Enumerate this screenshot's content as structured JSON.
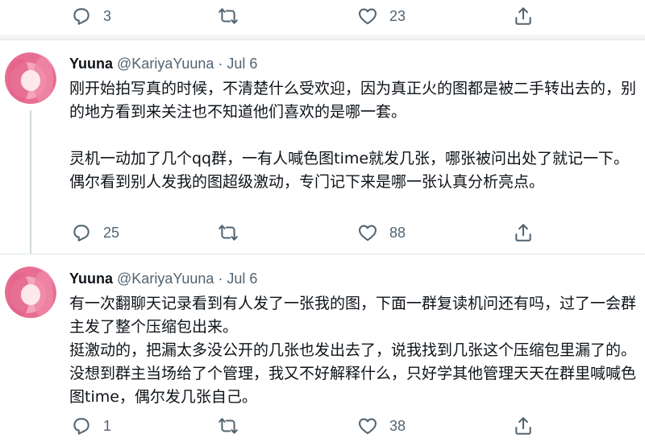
{
  "top_actions": {
    "reply_count": "3",
    "retweet_count": "",
    "like_count": "23"
  },
  "tweets": [
    {
      "author": {
        "name": "Yuuna",
        "handle": "@KariyaYuuna",
        "separator": "·",
        "date": "Jul 6"
      },
      "paragraphs": [
        "刚开始拍写真的时候，不清楚什么受欢迎，因为真正火的图都是被二手转出去的，别的地方看到来关注也不知道他们喜欢的是哪一套。",
        "",
        "灵机一动加了几个qq群，一有人喊色图time就发几张，哪张被问出处了就记一下。偶尔看到别人发我的图超级激动，专门记下来是哪一张认真分析亮点。"
      ],
      "actions": {
        "reply_count": "25",
        "retweet_count": "",
        "like_count": "88"
      }
    },
    {
      "author": {
        "name": "Yuuna",
        "handle": "@KariyaYuuna",
        "separator": "·",
        "date": "Jul 6"
      },
      "paragraphs": [
        "有一次翻聊天记录看到有人发了一张我的图，下面一群复读机问还有吗，过了一会群主发了整个压缩包出来。",
        "挺激动的，把漏太多没公开的几张也发出去了，说我找到几张这个压缩包里漏了的。没想到群主当场给了个管理，我又不好解释什么，只好学其他管理天天在群里喊喊色图time，偶尔发几张自己。"
      ],
      "actions": {
        "reply_count": "1",
        "retweet_count": "",
        "like_count": "38"
      }
    }
  ]
}
